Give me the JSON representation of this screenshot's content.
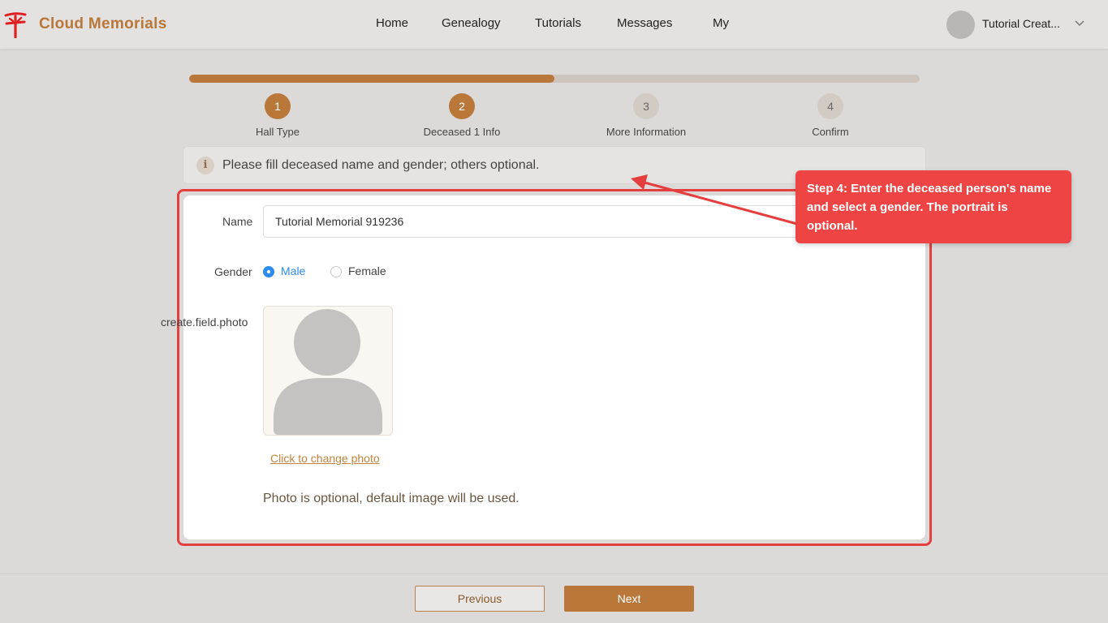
{
  "app": {
    "brand": "Cloud Memorials",
    "brand_color": "#b9773a",
    "logo_icon": "memorial-logo-icon"
  },
  "nav": {
    "items": [
      "Home",
      "Genealogy",
      "Tutorials",
      "Messages",
      "My"
    ]
  },
  "user": {
    "name": "Tutorial Creat...",
    "dropdown_icon": "chevron-down-icon"
  },
  "progress": {
    "fraction": 0.5
  },
  "steps": [
    {
      "number": "1",
      "label": "Hall Type",
      "state": "active"
    },
    {
      "number": "2",
      "label": "Deceased 1 Info",
      "state": "active"
    },
    {
      "number": "3",
      "label": "More Information",
      "state": "inactive"
    },
    {
      "number": "4",
      "label": "Confirm",
      "state": "inactive"
    }
  ],
  "info": {
    "icon": "i",
    "text": "Please fill deceased name and gender; others optional."
  },
  "form": {
    "name_label": "Name",
    "name_value": "Tutorial Memorial 919236",
    "gender_label": "Gender",
    "gender_options": [
      {
        "label": "Male",
        "checked": true
      },
      {
        "label": "Female",
        "checked": false
      }
    ],
    "photo_label": "create.field.photo",
    "change_photo": "Click to change photo",
    "photo_hint": "Photo is optional, default image will be used."
  },
  "callout": {
    "text": "Step 4: Enter the deceased person's name and select a gender. The portrait is optional.",
    "color": "#ef4444"
  },
  "footer": {
    "previous": "Previous",
    "next": "Next"
  }
}
